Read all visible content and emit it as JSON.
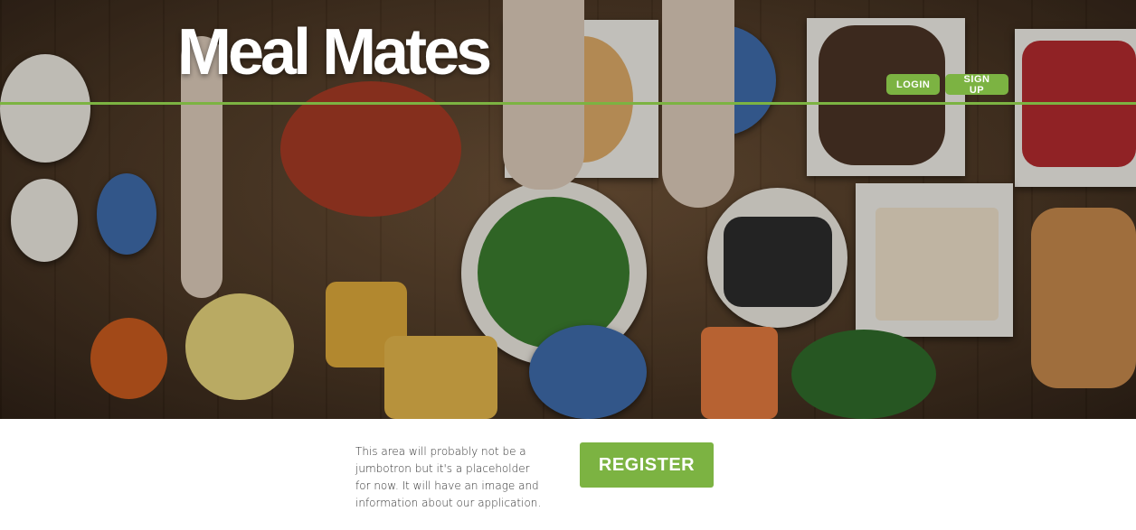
{
  "header": {
    "brand": "Meal Mates",
    "login_label": "LOGIN",
    "signup_label": "SIGN UP"
  },
  "main": {
    "info_text": "This area will probably not be a jumbotron but it's a placeholder for now. It will have an image and information about our application.",
    "register_label": "REGISTER"
  },
  "colors": {
    "accent": "#7cb342",
    "text": "#333333"
  }
}
